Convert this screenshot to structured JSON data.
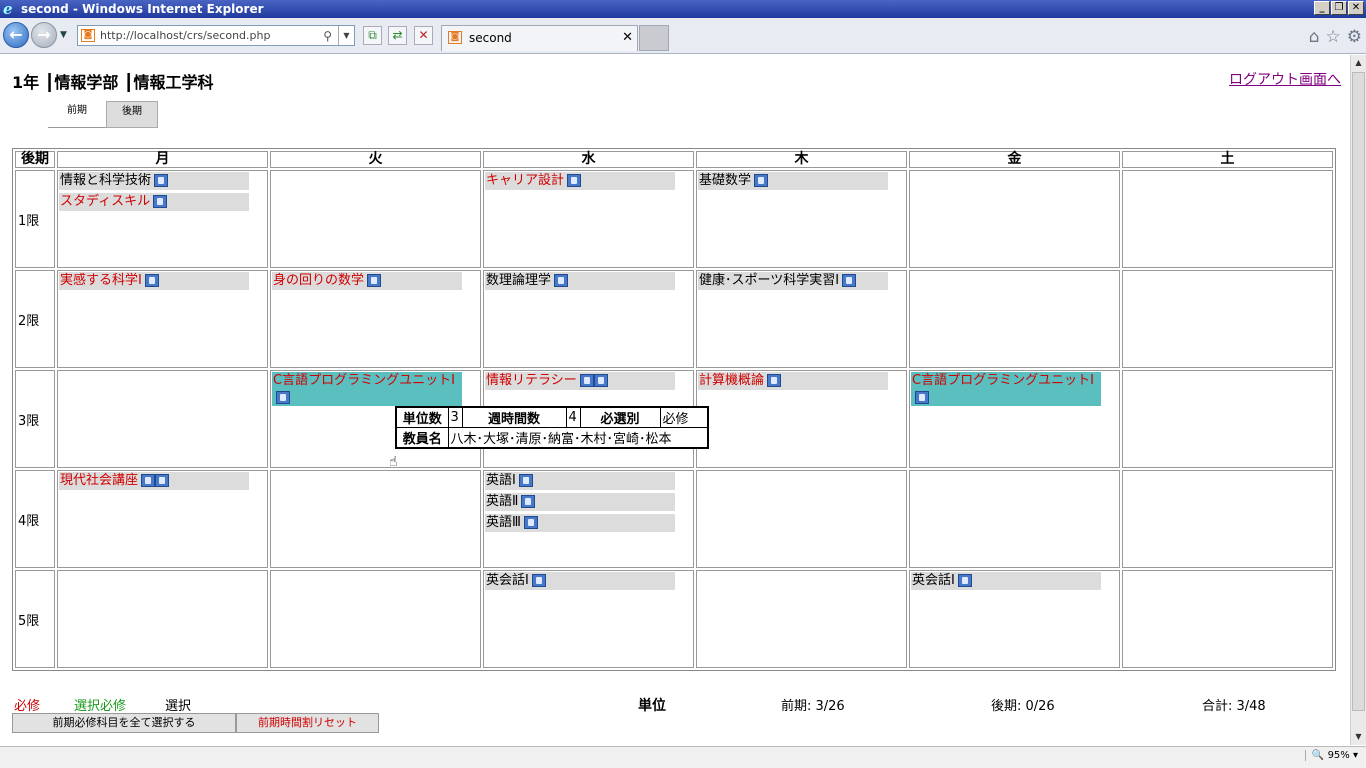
{
  "window": {
    "title": "second - Windows Internet Explorer"
  },
  "browser": {
    "url": "http://localhost/crs/second.php",
    "tab_title": "second",
    "zoom": "95%"
  },
  "page": {
    "header": "1年 ┃情報学部 ┃情報工学科",
    "logout": "ログアウト画面へ",
    "term_tabs": [
      "前期",
      "後期"
    ],
    "table_corner": "後期",
    "days": [
      "月",
      "火",
      "水",
      "木",
      "金",
      "土"
    ],
    "periods": [
      "1限",
      "2限",
      "3限",
      "4限",
      "5限"
    ],
    "courses": {
      "p1_mon_1": "情報と科学技術",
      "p1_mon_2": "スタディスキル",
      "p1_wed": "キャリア設計",
      "p1_thu": "基礎数学",
      "p2_mon": "実感する科学Ⅰ",
      "p2_tue": "身の回りの数学",
      "p2_wed": "数理論理学",
      "p2_thu": "健康･スポーツ科学実習Ⅰ",
      "p3_tue": "C言語プログラミングユニットⅠ",
      "p3_wed": "情報リテラシー",
      "p3_thu": "計算機概論",
      "p3_fri": "C言語プログラミングユニットⅠ",
      "p4_mon": "現代社会講座",
      "p4_wed_1": "英語Ⅰ",
      "p4_wed_2": "英語Ⅱ",
      "p4_wed_3": "英語Ⅲ",
      "p5_wed": "英会話Ⅰ",
      "p5_fri": "英会話Ⅰ"
    },
    "tooltip": {
      "units_label": "単位数",
      "units": "3",
      "hours_label": "週時間数",
      "hours": "4",
      "type_label": "必選別",
      "type": "必修",
      "teachers_label": "教員名",
      "teachers": "八木･大塚･清原･納富･木村･宮崎･松本"
    },
    "legend": {
      "required": "必修",
      "elective_required": "選択必修",
      "elective": "選択"
    },
    "credits": {
      "label": "単位",
      "first": "前期: 3/26",
      "second": "後期: 0/26",
      "total": "合計: 3/48"
    },
    "buttons": {
      "select_all": "前期必修科目を全て選択する",
      "reset": "前期時間割リセット"
    },
    "colors": {
      "required": "#d00000",
      "elective_required": "#1a9a1a",
      "selected_cell": "#5bbfbf"
    }
  }
}
